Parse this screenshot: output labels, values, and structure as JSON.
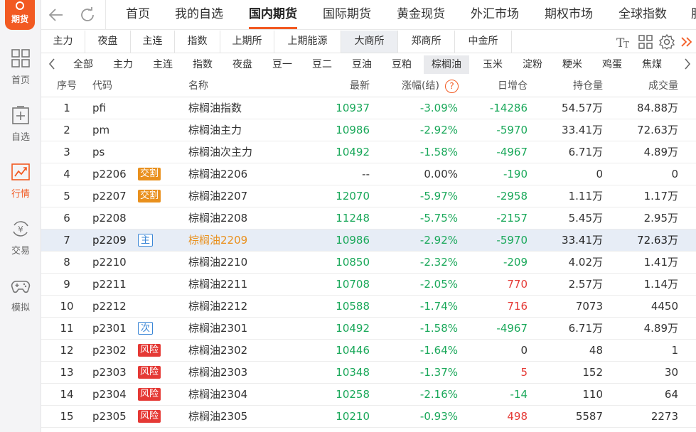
{
  "app": {
    "logo_text": "期货",
    "accent": "#f25a22"
  },
  "sidebar": {
    "items": [
      {
        "label": "首页",
        "icon": "grid-icon"
      },
      {
        "label": "自选",
        "icon": "add-box-icon"
      },
      {
        "label": "行情",
        "icon": "chart-icon",
        "active": true
      },
      {
        "label": "交易",
        "icon": "yuan-cycle-icon"
      },
      {
        "label": "模拟",
        "icon": "gamepad-icon"
      }
    ]
  },
  "top_tabs": [
    "首页",
    "我的自选",
    "国内期货",
    "国际期货",
    "黄金现货",
    "外汇市场",
    "期权市场",
    "全球指数",
    "股"
  ],
  "top_active": "国内期货",
  "exchange_tabs": [
    "主力",
    "夜盘",
    "主连",
    "指数",
    "上期所",
    "上期能源",
    "大商所",
    "郑商所",
    "中金所"
  ],
  "exchange_active": "大商所",
  "product_tabs": [
    "全部",
    "主力",
    "主连",
    "指数",
    "夜盘",
    "豆一",
    "豆二",
    "豆油",
    "豆粕",
    "棕榈油",
    "玉米",
    "淀粉",
    "粳米",
    "鸡蛋",
    "焦煤"
  ],
  "product_active": "棕榈油",
  "table": {
    "headers": {
      "idx": "序号",
      "code": "代码",
      "name": "名称",
      "last": "最新",
      "chg": "涨幅(结)",
      "daily": "日增仓",
      "oi": "持仓量",
      "vol": "成交量"
    },
    "help_glyph": "?",
    "rows": [
      {
        "idx": "1",
        "code": "pfi",
        "tag": "",
        "name": "棕榈油指数",
        "last": "10937",
        "chg": "-3.09%",
        "daily": "-14286",
        "oi": "54.57万",
        "vol": "84.88万"
      },
      {
        "idx": "2",
        "code": "pm",
        "tag": "",
        "name": "棕榈油主力",
        "last": "10986",
        "chg": "-2.92%",
        "daily": "-5970",
        "oi": "33.41万",
        "vol": "72.63万"
      },
      {
        "idx": "3",
        "code": "ps",
        "tag": "",
        "name": "棕榈油次主力",
        "last": "10492",
        "chg": "-1.58%",
        "daily": "-4967",
        "oi": "6.71万",
        "vol": "4.89万"
      },
      {
        "idx": "4",
        "code": "p2206",
        "tag": "交割",
        "name": "棕榈油2206",
        "last": "--",
        "chg": "0.00%",
        "daily": "-190",
        "oi": "0",
        "vol": "0"
      },
      {
        "idx": "5",
        "code": "p2207",
        "tag": "交割",
        "name": "棕榈油2207",
        "last": "12070",
        "chg": "-5.97%",
        "daily": "-2958",
        "oi": "1.11万",
        "vol": "1.17万"
      },
      {
        "idx": "6",
        "code": "p2208",
        "tag": "",
        "name": "棕榈油2208",
        "last": "11248",
        "chg": "-5.75%",
        "daily": "-2157",
        "oi": "5.45万",
        "vol": "2.95万"
      },
      {
        "idx": "7",
        "code": "p2209",
        "tag": "主",
        "name": "棕榈油2209",
        "last": "10986",
        "chg": "-2.92%",
        "daily": "-5970",
        "oi": "33.41万",
        "vol": "72.63万",
        "selected": true
      },
      {
        "idx": "8",
        "code": "p2210",
        "tag": "",
        "name": "棕榈油2210",
        "last": "10850",
        "chg": "-2.32%",
        "daily": "-209",
        "oi": "4.02万",
        "vol": "1.41万"
      },
      {
        "idx": "9",
        "code": "p2211",
        "tag": "",
        "name": "棕榈油2211",
        "last": "10708",
        "chg": "-2.05%",
        "daily": "770",
        "oi": "2.57万",
        "vol": "1.14万"
      },
      {
        "idx": "10",
        "code": "p2212",
        "tag": "",
        "name": "棕榈油2212",
        "last": "10588",
        "chg": "-1.74%",
        "daily": "716",
        "oi": "7073",
        "vol": "4450"
      },
      {
        "idx": "11",
        "code": "p2301",
        "tag": "次",
        "name": "棕榈油2301",
        "last": "10492",
        "chg": "-1.58%",
        "daily": "-4967",
        "oi": "6.71万",
        "vol": "4.89万"
      },
      {
        "idx": "12",
        "code": "p2302",
        "tag": "风险",
        "name": "棕榈油2302",
        "last": "10446",
        "chg": "-1.64%",
        "daily": "0",
        "oi": "48",
        "vol": "1"
      },
      {
        "idx": "13",
        "code": "p2303",
        "tag": "风险",
        "name": "棕榈油2303",
        "last": "10348",
        "chg": "-1.37%",
        "daily": "5",
        "oi": "152",
        "vol": "30"
      },
      {
        "idx": "14",
        "code": "p2304",
        "tag": "风险",
        "name": "棕榈油2304",
        "last": "10258",
        "chg": "-2.16%",
        "daily": "-14",
        "oi": "110",
        "vol": "64"
      },
      {
        "idx": "15",
        "code": "p2305",
        "tag": "风险",
        "name": "棕榈油2305",
        "last": "10210",
        "chg": "-0.93%",
        "daily": "498",
        "oi": "5587",
        "vol": "2273"
      }
    ]
  },
  "colors": {
    "up": "#e53935",
    "down": "#1aa85a",
    "highlight": "#e9901d",
    "tag_main": "#3a86d6"
  }
}
